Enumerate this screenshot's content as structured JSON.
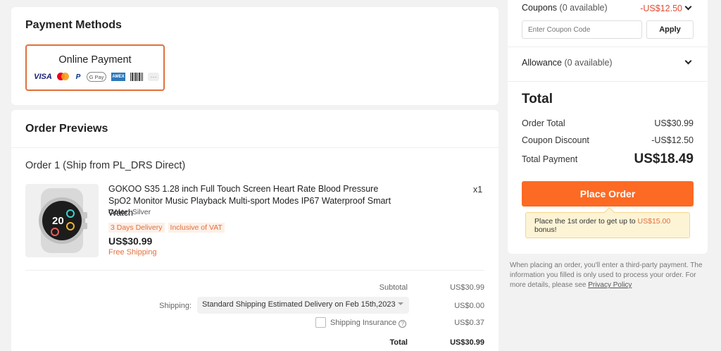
{
  "payment": {
    "title": "Payment Methods",
    "option_label": "Online Payment",
    "icons": [
      "visa-icon",
      "mastercard-icon",
      "paypal-icon",
      "google-pay-icon",
      "amex-icon",
      "boleto-icon",
      "more-icon"
    ],
    "visa_text": "VISA",
    "paypal_text": "P",
    "gpay_text": "G Pay",
    "amex_text": "AMEX",
    "more_text": "···",
    "accent": "#e0703b"
  },
  "order": {
    "title": "Order Previews",
    "subtitle": "Order 1 (Ship from PL_DRS Direct)",
    "product": {
      "name": "GOKOO S35 1.28 inch Full Touch Screen Heart Rate Blood Pressure SpO2 Monitor Music Playback Multi-sport Modes IP67 Waterproof Smart Watch",
      "qty": "x1",
      "color_label": "Color:",
      "color_value": "Silver",
      "tags": [
        "3 Days Delivery",
        "Inclusive of VAT"
      ],
      "price": "US$30.99",
      "shipping": "Free Shipping",
      "watch_time": "20"
    },
    "summary": {
      "subtotal_label": "Subtotal",
      "subtotal_value": "US$30.99",
      "shipping_label": "Shipping:",
      "shipping_option": "Standard Shipping Estimated Delivery on Feb 15th,2023",
      "shipping_value": "US$0.00",
      "insurance_label": "Shipping Insurance",
      "insurance_value": "US$0.37",
      "total_label": "Total",
      "total_value": "US$30.99"
    }
  },
  "summary": {
    "coupons_label": "Coupons",
    "coupons_count": "(0 available)",
    "coupons_discount": "-US$12.50",
    "coupon_placeholder": "Enter Coupon Code",
    "apply_label": "Apply",
    "allowance_label": "Allowance",
    "allowance_count": "(0 available)",
    "total_title": "Total",
    "order_total_label": "Order Total",
    "order_total_value": "US$30.99",
    "coupon_discount_label": "Coupon Discount",
    "coupon_discount_value": "-US$12.50",
    "total_payment_label": "Total Payment",
    "total_payment_value": "US$18.49",
    "place_order_label": "Place Order",
    "tip_prefix": "Place the 1st order to get up to",
    "tip_amount": "US$15.00",
    "tip_suffix": "bonus!",
    "button_color": "#fd6a23"
  },
  "footer_note": {
    "text": "When placing an order, you'll enter a third-party payment. The information you filled is only used to process your order. For more details, please see",
    "link": "Privacy Policy"
  }
}
